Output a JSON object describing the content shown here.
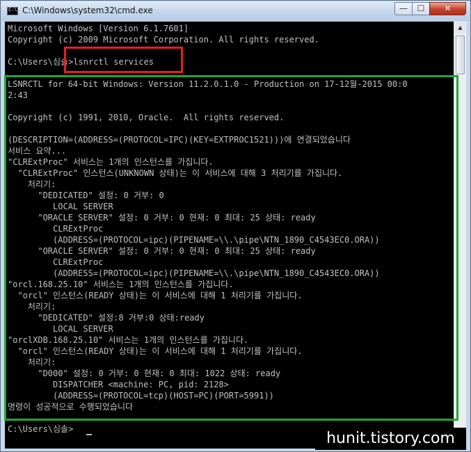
{
  "window": {
    "title": "C:\\Windows\\system32\\cmd.exe",
    "buttons": {
      "minimize": "—",
      "maximize": "☐",
      "close": "✕"
    }
  },
  "console": {
    "lines": [
      "Microsoft Windows [Version 6.1.7601]",
      "Copyright (c) 2009 Microsoft Corporation. All rights reserved.",
      "",
      "C:\\Users\\심솔>lsnrctl services",
      "",
      "LSNRCTL for 64-bit Windows: Version 11.2.0.1.0 - Production on 17-12월-2015 00:0",
      "2:43",
      "",
      "Copyright (c) 1991, 2010, Oracle.  All rights reserved.",
      "",
      "(DESCRIPTION=(ADDRESS=(PROTOCOL=IPC)(KEY=EXTPROC1521)))에 연결되었습니다",
      "서비스 요약...",
      "\"CLRExtProc\" 서비스는 1개의 인스턴스를 가집니다.",
      "  \"CLRExtProc\" 인스턴스(UNKNOWN 상태)는 이 서비스에 대해 3 처리기를 가집니다.",
      "    처리기:",
      "      \"DEDICATED\" 설정: 0 거부: 0",
      "         LOCAL SERVER",
      "      \"ORACLE SERVER\" 설정: 0 거부: 0 현재: 0 최대: 25 상태: ready",
      "         CLRExtProc",
      "         (ADDRESS=(PROTOCOL=ipc)(PIPENAME=\\\\.\\pipe\\NTN_1890_C4543EC0.ORA))",
      "      \"ORACLE SERVER\" 설정: 0 거부: 0 현재: 0 최대: 25 상태: ready",
      "         CLRExtProc",
      "         (ADDRESS=(PROTOCOL=ipc)(PIPENAME=\\\\.\\pipe\\NTN_1890_C4543EC0.ORA))",
      "\"orcl.168.25.10\" 서비스는 1개의 인스턴스를 가집니다.",
      "  \"orcl\" 인스턴스(READY 상태)는 이 서비스에 대해 1 처리기를 가집니다.",
      "    처리기:",
      "      \"DEDICATED\" 설정:8 거부:0 상태:ready",
      "         LOCAL SERVER",
      "\"orclXDB.168.25.10\" 서비스는 1개의 인스턴스를 가집니다.",
      "  \"orcl\" 인스턴스(READY 상태)는 이 서비스에 대해 1 처리기를 가집니다.",
      "    처리기:",
      "      \"D000\" 설정: 0 거부: 0 현재: 0 최대: 1022 상태: ready",
      "         DISPATCHER <machine: PC, pid: 2128>",
      "         (ADDRESS=(PROTOCOL=tcp)(HOST=PC)(PORT=5991))",
      "명령이 성공적으로 수행되었습니다",
      "",
      "C:\\Users\\심솔>"
    ]
  },
  "watermark": "hunit.tistory.com",
  "colors": {
    "console_background": "#000000",
    "console_text": "#c0c0c0",
    "highlight_command": "#e81f1f",
    "highlight_output": "#1ea837"
  }
}
